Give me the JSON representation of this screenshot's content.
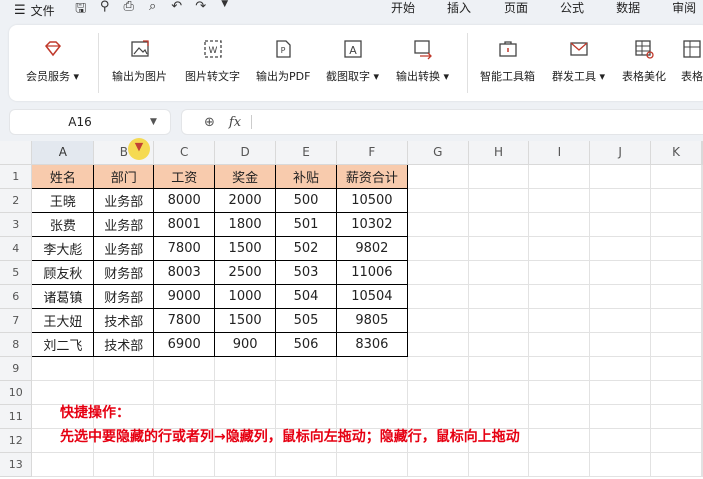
{
  "menubar": {
    "file_label": "文件",
    "tabs": [
      "开始",
      "插入",
      "页面",
      "公式",
      "数据",
      "审阅"
    ]
  },
  "ribbon": {
    "buttons": [
      {
        "label": "会员服务",
        "icon": "diamond-icon",
        "dropdown": true
      },
      {
        "label": "输出为图片",
        "icon": "image-export-icon",
        "dropdown": false
      },
      {
        "label": "图片转文字",
        "icon": "image-to-text-icon",
        "dropdown": false
      },
      {
        "label": "输出为PDF",
        "icon": "pdf-export-icon",
        "dropdown": false
      },
      {
        "label": "截图取字",
        "icon": "screenshot-text-icon",
        "dropdown": true
      },
      {
        "label": "输出转换",
        "icon": "convert-icon",
        "dropdown": true
      },
      {
        "label": "智能工具箱",
        "icon": "toolbox-icon",
        "dropdown": false
      },
      {
        "label": "群发工具",
        "icon": "mail-icon",
        "dropdown": true
      },
      {
        "label": "表格美化",
        "icon": "table-beautify-icon",
        "dropdown": false
      },
      {
        "label": "表格",
        "icon": "table-icon",
        "dropdown": false
      }
    ]
  },
  "formula": {
    "cell_ref": "A16",
    "zoom_icon": "zoom-icon",
    "fx_label": "fx",
    "value": ""
  },
  "sheet": {
    "columns": [
      "A",
      "B",
      "C",
      "D",
      "E",
      "F",
      "G",
      "H",
      "I",
      "J",
      "K"
    ],
    "rows": [
      "1",
      "2",
      "3",
      "4",
      "5",
      "6",
      "7",
      "8",
      "9",
      "10",
      "11",
      "12",
      "13"
    ],
    "headers": [
      "姓名",
      "部门",
      "工资",
      "奖金",
      "补贴",
      "薪资合计"
    ],
    "data": [
      [
        "王晓",
        "业务部",
        "8000",
        "2000",
        "500",
        "10500"
      ],
      [
        "张费",
        "业务部",
        "8001",
        "1800",
        "501",
        "10302"
      ],
      [
        "李大彪",
        "业务部",
        "7800",
        "1500",
        "502",
        "9802"
      ],
      [
        "顾友秋",
        "财务部",
        "8003",
        "2500",
        "503",
        "11006"
      ],
      [
        "诸葛镇",
        "财务部",
        "9000",
        "1000",
        "504",
        "10504"
      ],
      [
        "王大妞",
        "技术部",
        "7800",
        "1500",
        "505",
        "9805"
      ],
      [
        "刘二飞",
        "技术部",
        "6900",
        "900",
        "506",
        "8306"
      ]
    ]
  },
  "annotation": {
    "title": "快捷操作：",
    "body": "先选中要隐藏的行或者列→隐藏列，鼠标向左拖动；隐藏行，鼠标向上拖动"
  },
  "colors": {
    "header_fill": "#f8cbad",
    "annotation_text": "#e60012",
    "drag_marker": "#f6d94a"
  }
}
